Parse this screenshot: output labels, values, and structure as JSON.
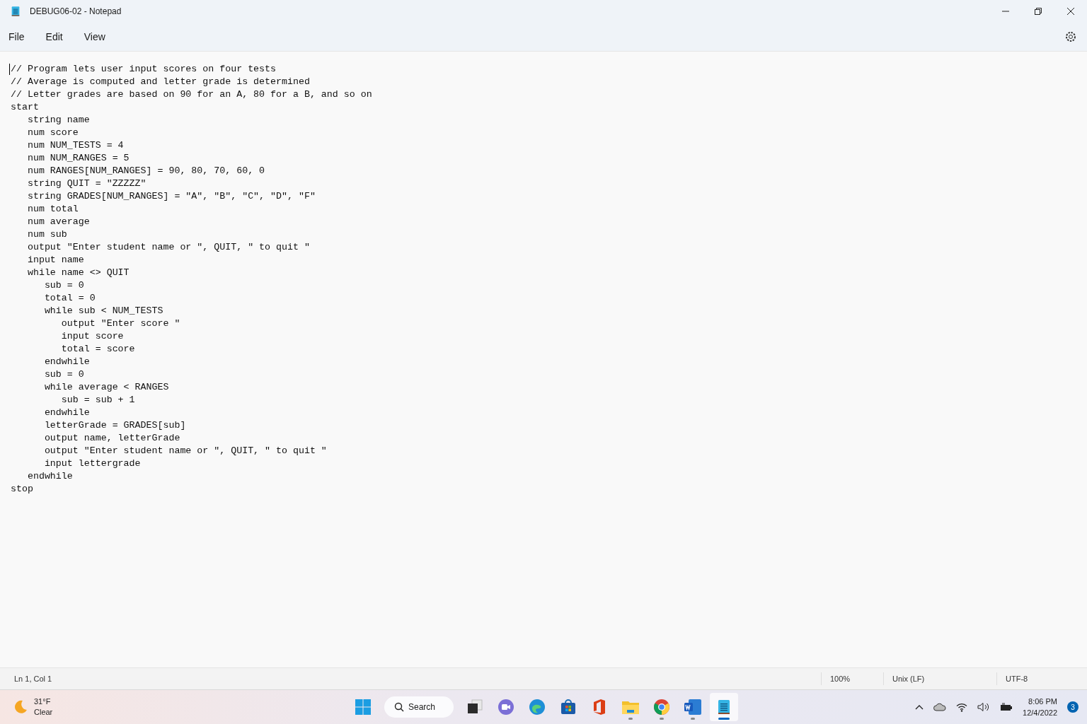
{
  "window": {
    "title": "DEBUG06-02 - Notepad"
  },
  "menu": [
    "File",
    "Edit",
    "View"
  ],
  "editor": {
    "lines": [
      "// Program lets user input scores on four tests",
      "// Average is computed and letter grade is determined",
      "// Letter grades are based on 90 for an A, 80 for a B, and so on",
      "start",
      "   string name",
      "   num score",
      "   num NUM_TESTS = 4",
      "   num NUM_RANGES = 5",
      "   num RANGES[NUM_RANGES] = 90, 80, 70, 60, 0",
      "   string QUIT = \"ZZZZZ\"",
      "   string GRADES[NUM_RANGES] = \"A\", \"B\", \"C\", \"D\", \"F\"",
      "   num total",
      "   num average",
      "   num sub",
      "   output \"Enter student name or \", QUIT, \" to quit \"",
      "   input name",
      "   while name <> QUIT",
      "      sub = 0",
      "      total = 0",
      "      while sub < NUM_TESTS",
      "         output \"Enter score \"",
      "         input score",
      "         total = score",
      "      endwhile",
      "      sub = 0",
      "      while average < RANGES",
      "         sub = sub + 1",
      "      endwhile",
      "      letterGrade = GRADES[sub]",
      "      output name, letterGrade",
      "      output \"Enter student name or \", QUIT, \" to quit \"",
      "      input lettergrade",
      "   endwhile",
      "stop"
    ]
  },
  "status_bar": {
    "position": "Ln 1, Col 1",
    "zoom": "100%",
    "line_ending": "Unix (LF)",
    "encoding": "UTF-8"
  },
  "taskbar": {
    "weather": {
      "temperature": "31°F",
      "condition": "Clear"
    },
    "search": {
      "label": "Search"
    },
    "apps": [
      {
        "kind": "taskview",
        "running": false,
        "selected": false
      },
      {
        "kind": "chat",
        "running": false,
        "selected": false
      },
      {
        "kind": "edge",
        "running": false,
        "selected": false
      },
      {
        "kind": "store",
        "running": false,
        "selected": false
      },
      {
        "kind": "office",
        "running": false,
        "selected": false
      },
      {
        "kind": "explorer",
        "running": true,
        "selected": false
      },
      {
        "kind": "chrome",
        "running": true,
        "selected": false
      },
      {
        "kind": "word",
        "running": true,
        "selected": false
      },
      {
        "kind": "notepad",
        "running": true,
        "selected": true
      }
    ],
    "time": "8:06 PM",
    "date": "12/4/2022",
    "notification_count": "3"
  }
}
